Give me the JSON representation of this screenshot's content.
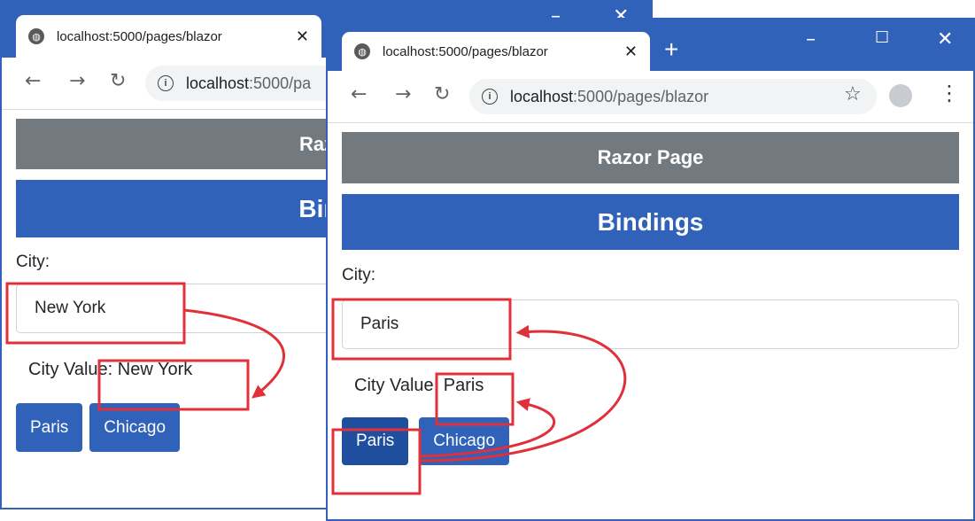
{
  "left_window": {
    "tab_title": "localhost:5000/pages/blazor",
    "url_host": "localhost",
    "url_path": ":5000/pa",
    "header_gray": "Razor",
    "header_blue": "Bind",
    "city_label": "City:",
    "city_input_value": "New York",
    "city_value_prefix": "City Value: ",
    "city_value": "New York",
    "buttons": [
      "Paris",
      "Chicago"
    ]
  },
  "right_window": {
    "tab_title": "localhost:5000/pages/blazor",
    "url_host": "localhost",
    "url_path": ":5000/pages/blazor",
    "header_gray": "Razor Page",
    "header_blue": "Bindings",
    "city_label": "City:",
    "city_input_value": "Paris",
    "city_value_prefix": "City Value: ",
    "city_value": "Paris",
    "buttons": [
      "Paris",
      "Chicago"
    ]
  },
  "icons": {
    "close": "✕",
    "new_tab": "+",
    "minimize": "–",
    "maximize": "☐",
    "window_close": "✕",
    "back": "←",
    "forward": "→",
    "reload": "↻",
    "info": "i",
    "star": "☆",
    "menu": "⋮"
  },
  "colors": {
    "titlebar": "#2f62b8",
    "header_gray": "#727a80",
    "header_blue": "#2f62b8",
    "button": "#2f62b8",
    "annotation": "#e0303a"
  }
}
